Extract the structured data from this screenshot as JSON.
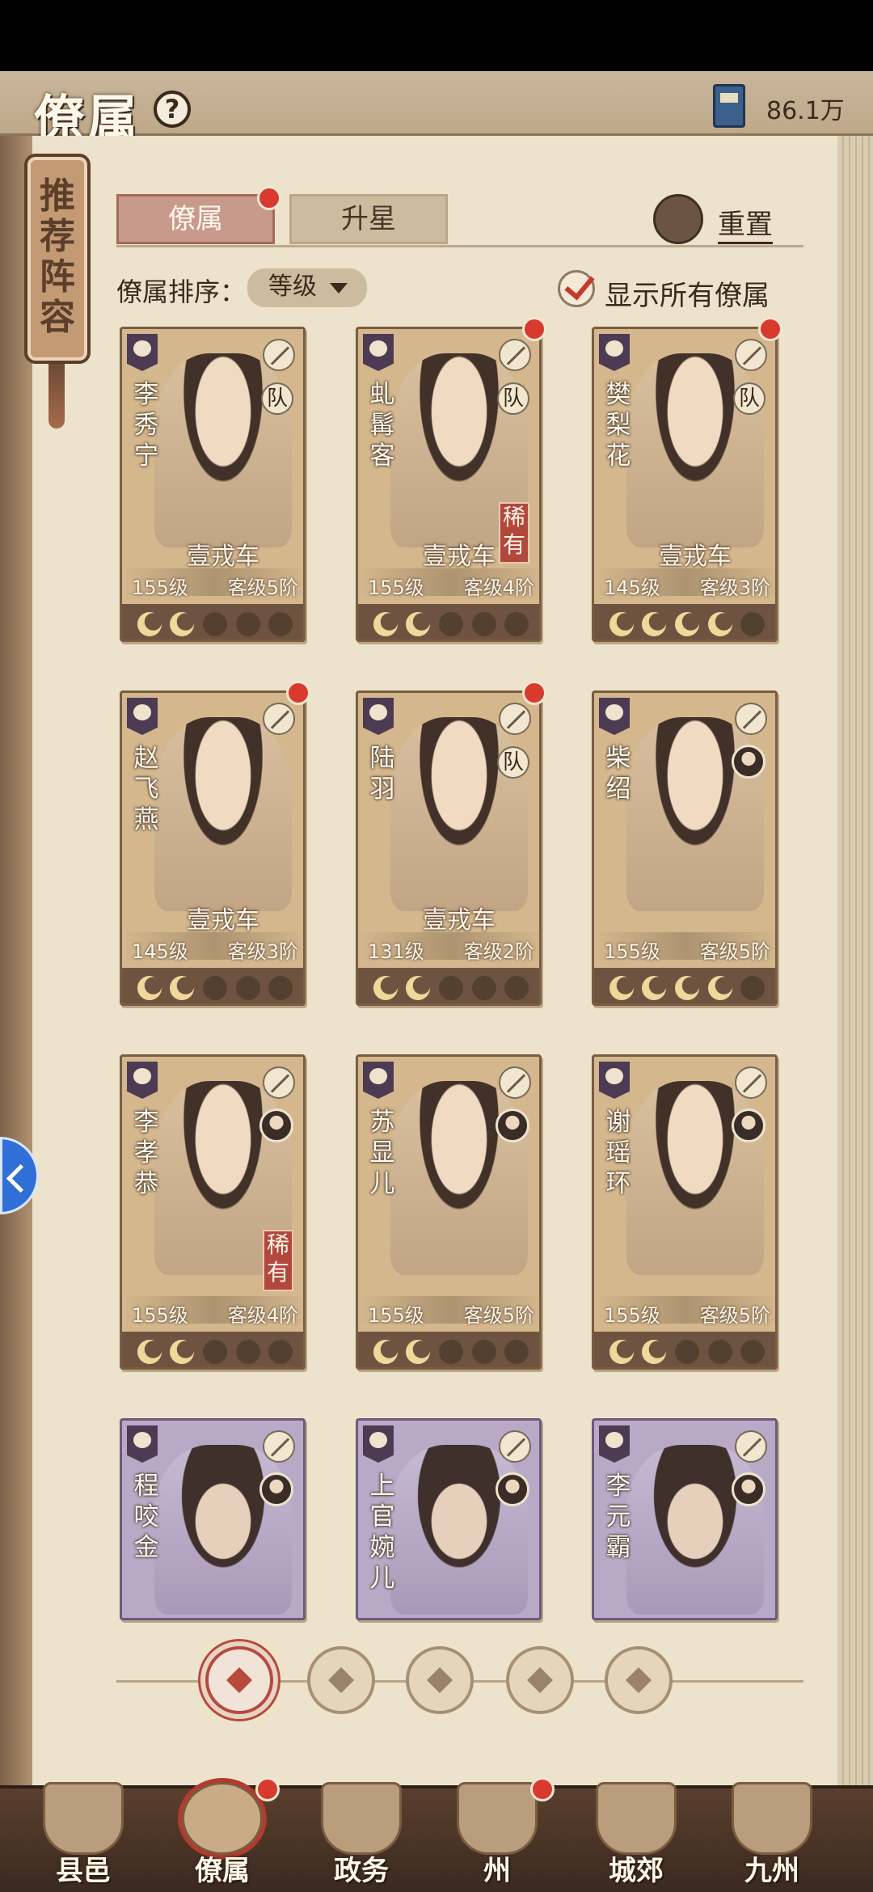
{
  "header": {
    "title": "僚属",
    "currency_value": "86.1万",
    "icons": {
      "help": "help-icon",
      "currency": "book-icon"
    }
  },
  "recommend": {
    "label": "推荐阵容"
  },
  "tabs": [
    {
      "label": "僚属",
      "active": true,
      "has_dot": true
    },
    {
      "label": "升星",
      "active": false,
      "has_dot": false
    }
  ],
  "reset_label": "重置",
  "sort": {
    "label": "僚属排序：",
    "value": "等级"
  },
  "show_all": {
    "label": "显示所有僚属",
    "checked": true
  },
  "cards": [
    {
      "name": "李秀宁",
      "title": "壹戎车",
      "level": "155级",
      "rank": "客级5阶",
      "team": "队",
      "rare": "",
      "moons": 2,
      "dot": false,
      "purple": false
    },
    {
      "name": "虬髯客",
      "title": "壹戎车",
      "level": "155级",
      "rank": "客级4阶",
      "team": "队",
      "rare": "稀有",
      "moons": 2,
      "dot": true,
      "purple": false
    },
    {
      "name": "樊梨花",
      "title": "壹戎车",
      "level": "145级",
      "rank": "客级3阶",
      "team": "队",
      "rare": "",
      "moons": 4,
      "dot": true,
      "purple": false
    },
    {
      "name": "赵飞燕",
      "title": "壹戎车",
      "level": "145级",
      "rank": "客级3阶",
      "team": "",
      "rare": "",
      "moons": 2,
      "dot": true,
      "purple": false
    },
    {
      "name": "陆羽",
      "title": "壹戎车",
      "level": "131级",
      "rank": "客级2阶",
      "team": "队",
      "rare": "",
      "moons": 2,
      "dot": true,
      "purple": false
    },
    {
      "name": "柴绍",
      "title": "",
      "level": "155级",
      "rank": "客级5阶",
      "team": "",
      "rare": "",
      "moons": 4,
      "dot": false,
      "purple": false
    },
    {
      "name": "李孝恭",
      "title": "",
      "level": "155级",
      "rank": "客级4阶",
      "team": "",
      "rare": "稀有",
      "moons": 2,
      "dot": false,
      "purple": false
    },
    {
      "name": "苏显儿",
      "title": "",
      "level": "155级",
      "rank": "客级5阶",
      "team": "",
      "rare": "",
      "moons": 2,
      "dot": false,
      "purple": false
    },
    {
      "name": "谢瑶环",
      "title": "",
      "level": "155级",
      "rank": "客级5阶",
      "team": "",
      "rare": "",
      "moons": 2,
      "dot": false,
      "purple": false
    },
    {
      "name": "程咬金",
      "title": "",
      "level": "",
      "rank": "",
      "team": "",
      "rare": "",
      "moons": 0,
      "dot": false,
      "purple": true
    },
    {
      "name": "上官婉儿",
      "title": "",
      "level": "",
      "rank": "",
      "team": "",
      "rare": "",
      "moons": 0,
      "dot": false,
      "purple": true
    },
    {
      "name": "李元霸",
      "title": "",
      "level": "",
      "rank": "",
      "team": "",
      "rare": "",
      "moons": 0,
      "dot": false,
      "purple": true
    }
  ],
  "filters": [
    {
      "icon": "all-filter-icon",
      "active": true
    },
    {
      "icon": "faction-filter-icon",
      "active": false
    },
    {
      "icon": "gourd-filter-icon",
      "active": false
    },
    {
      "icon": "fan-filter-icon",
      "active": false
    },
    {
      "icon": "lion-filter-icon",
      "active": false
    }
  ],
  "nav": [
    {
      "label": "县邑",
      "active": false,
      "dot": false
    },
    {
      "label": "僚属",
      "active": true,
      "dot": true
    },
    {
      "label": "政务",
      "active": false,
      "dot": false
    },
    {
      "label": "州",
      "active": false,
      "dot": true
    },
    {
      "label": "城郊",
      "active": false,
      "dot": false
    },
    {
      "label": "九州",
      "active": false,
      "dot": false
    }
  ],
  "colors": {
    "accent": "#b54a3d",
    "paper": "#ede3cc",
    "card": "#d4b78d",
    "card_purple": "#b8aac6"
  }
}
